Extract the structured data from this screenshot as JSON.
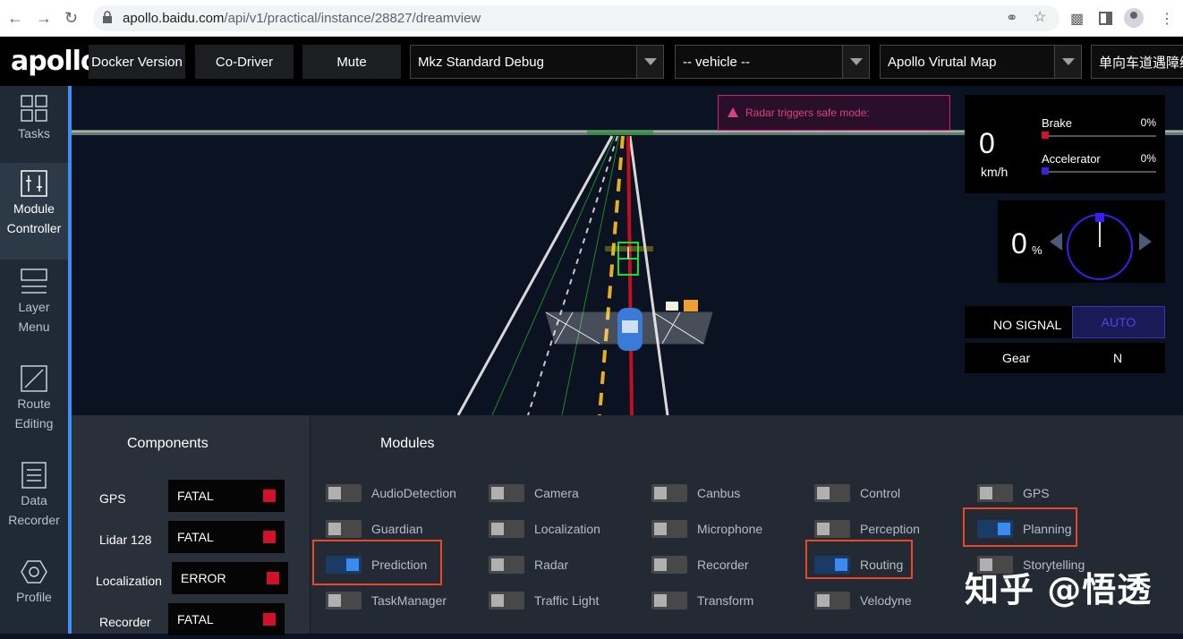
{
  "browser": {
    "url_host": "apollo.baidu.com",
    "url_path": "/api/v1/practical/instance/28827/dreamview"
  },
  "header": {
    "logo": "apollo",
    "docker_button": "Docker Version",
    "codriver_button": "Co-Driver",
    "mute_button": "Mute",
    "mode_select": "Mkz Standard Debug",
    "vehicle_select": "-- vehicle --",
    "map_select": "Apollo Virutal Map",
    "scenario_select": "单向车道遇障绕"
  },
  "sidebar": {
    "tasks": "Tasks",
    "module_controller_1": "Module",
    "module_controller_2": "Controller",
    "layer_menu_1": "Layer",
    "layer_menu_2": "Menu",
    "route_editing_1": "Route",
    "route_editing_2": "Editing",
    "data_recorder_1": "Data",
    "data_recorder_2": "Recorder",
    "profile": "Profile"
  },
  "scene": {
    "alert": "Radar triggers safe mode:",
    "speed_value": "0",
    "speed_unit": "km/h",
    "brake_label": "Brake",
    "brake_pct": "0%",
    "brake_value": 0,
    "accel_label": "Accelerator",
    "accel_pct": "0%",
    "accel_value": 0,
    "steer_value": "0",
    "steer_unit": "%",
    "signal": "NO SIGNAL",
    "drive_mode": "AUTO",
    "gear_label": "Gear",
    "gear_value": "N",
    "colors": {
      "brake": "#d0112b",
      "accel": "#4020e0",
      "steer": "#3a1ef0"
    }
  },
  "components": {
    "title": "Components",
    "items": [
      {
        "name": "GPS",
        "status": "FATAL"
      },
      {
        "name": "Lidar 128",
        "status": "FATAL"
      },
      {
        "name": "Localization",
        "status": "ERROR"
      },
      {
        "name": "Recorder",
        "status": "FATAL"
      }
    ]
  },
  "modules": {
    "title": "Modules",
    "columns": [
      [
        {
          "label": "AudioDetection",
          "on": false
        },
        {
          "label": "Guardian",
          "on": false
        },
        {
          "label": "Prediction",
          "on": true
        },
        {
          "label": "TaskManager",
          "on": false
        }
      ],
      [
        {
          "label": "Camera",
          "on": false
        },
        {
          "label": "Localization",
          "on": false
        },
        {
          "label": "Radar",
          "on": false
        },
        {
          "label": "Traffic Light",
          "on": false
        }
      ],
      [
        {
          "label": "Canbus",
          "on": false
        },
        {
          "label": "Microphone",
          "on": false
        },
        {
          "label": "Recorder",
          "on": false
        },
        {
          "label": "Transform",
          "on": false
        }
      ],
      [
        {
          "label": "Control",
          "on": false
        },
        {
          "label": "Perception",
          "on": false
        },
        {
          "label": "Routing",
          "on": true
        },
        {
          "label": "Velodyne",
          "on": false
        }
      ],
      [
        {
          "label": "GPS",
          "on": false
        },
        {
          "label": "Planning",
          "on": true
        },
        {
          "label": "Storytelling",
          "on": false
        }
      ]
    ]
  },
  "watermark": "知乎 @悟透"
}
